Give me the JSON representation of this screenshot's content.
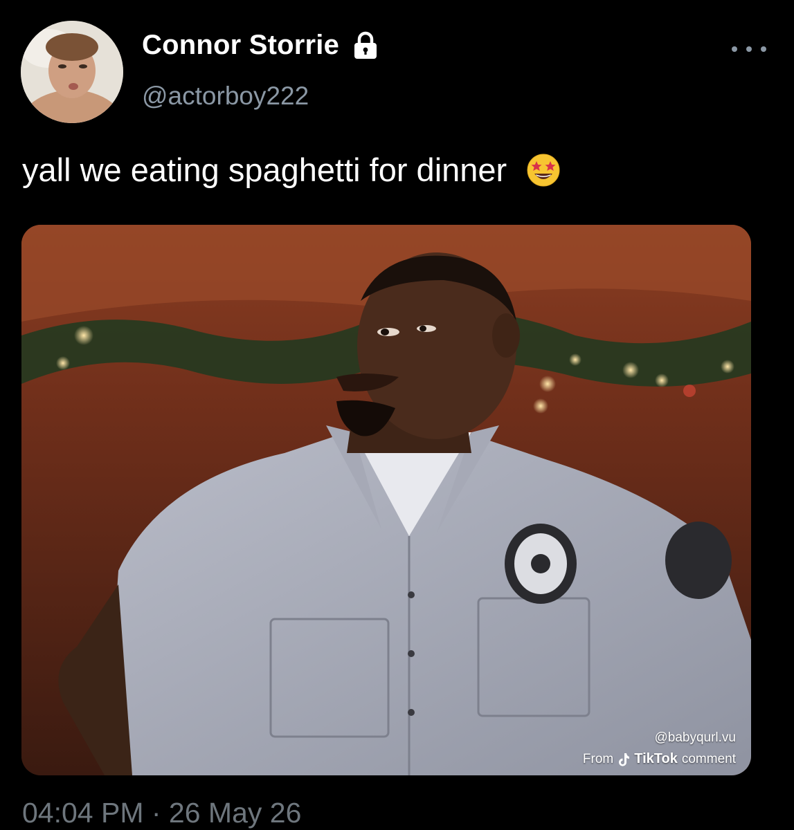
{
  "author": {
    "display_name": "Connor Storrie",
    "handle": "@actorboy222",
    "lock_icon": "lock-icon",
    "avatar_icon": "avatar"
  },
  "more_icon": "more-horizontal-icon",
  "tweet": {
    "text": "yall we eating spaghetti for dinner",
    "emoji": "star-struck-emoji"
  },
  "media": {
    "watermark_user": "@babyqurl.vu",
    "watermark_from": "From",
    "watermark_brand": "TikTok",
    "watermark_comment": "comment"
  },
  "meta": {
    "timestamp": "04:04 PM · 26 May 26"
  },
  "colors": {
    "background": "#000000",
    "secondary_text": "#8b98a5",
    "timestamp_text": "#6e767d"
  }
}
